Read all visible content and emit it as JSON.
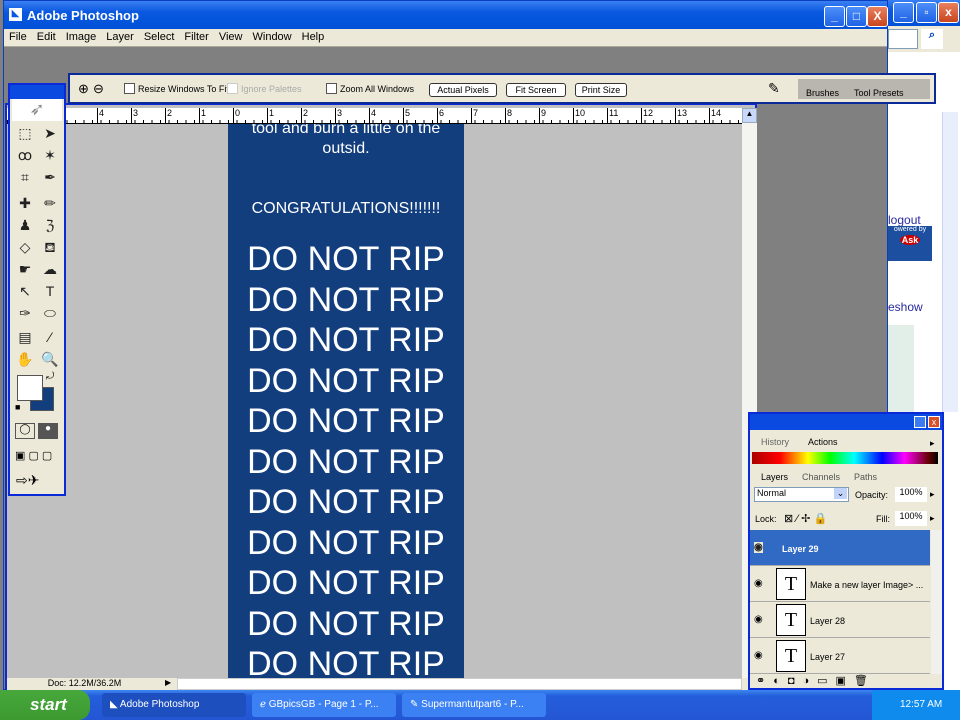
{
  "ie": {
    "logout": "logout",
    "powered": "owered by",
    "ask": "Ask",
    "slideshow": "eshow"
  },
  "window": {
    "title": "Adobe Photoshop",
    "min": "_",
    "max": "□",
    "close": "X"
  },
  "menu": [
    "File",
    "Edit",
    "Image",
    "Layer",
    "Select",
    "Filter",
    "View",
    "Window",
    "Help"
  ],
  "options": {
    "resize": "Resize Windows To Fit",
    "ignore": "Ignore Palettes",
    "zoom_all": "Zoom All Windows",
    "actual": "Actual Pixels",
    "fit": "Fit Screen",
    "print": "Print Size",
    "tabs": [
      "Brushes",
      "Tool Presets"
    ]
  },
  "ruler": [
    "4",
    "3",
    "2",
    "1",
    "0",
    "1",
    "2",
    "3",
    "4",
    "5",
    "6",
    "7",
    "8",
    "9",
    "10",
    "11",
    "12",
    "13",
    "14",
    "1"
  ],
  "canvas": {
    "line1": "tool and burn a little on the",
    "line2": "outsid.",
    "congrats": "CONGRATULATIONS!!!!!!!",
    "rip": [
      "DO NOT RIP",
      "DO NOT RIP",
      "DO NOT RIP",
      "DO NOT RIP",
      "DO NOT RIP",
      "DO NOT RIP",
      "DO NOT RIP",
      "DO NOT RIP",
      "DO NOT RIP",
      "DO NOT RIP",
      "DO NOT RIP"
    ]
  },
  "status": "Doc: 12.2M/36.2M",
  "colors": {
    "foreground": "#ffffff",
    "background": "#123e7e",
    "accent": "#0a2ad8"
  },
  "palette": {
    "tabs_top": [
      "History",
      "Actions"
    ],
    "tabs": [
      "Layers",
      "Channels",
      "Paths"
    ],
    "blend": "Normal",
    "opacity_label": "Opacity:",
    "opacity": "100%",
    "lock": "Lock:",
    "fill_label": "Fill:",
    "fill": "100%",
    "layers": [
      {
        "name": "Layer 29",
        "selected": true
      },
      {
        "name": "Make a new layer Image> ...",
        "type": "T"
      },
      {
        "name": "Layer 28",
        "type": "T"
      },
      {
        "name": "Layer 27",
        "type": "T"
      }
    ]
  },
  "taskbar": {
    "start": "start",
    "items": [
      "Adobe Photoshop",
      "GBpicsGB - Page 1 - P...",
      "Supermantutpart6 - P..."
    ],
    "clock": "12:57 AM"
  }
}
